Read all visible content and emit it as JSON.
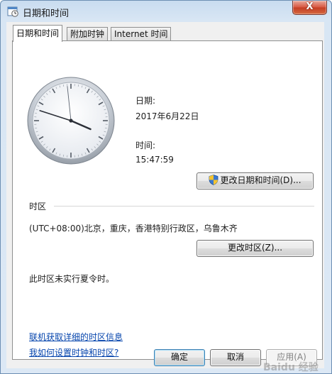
{
  "window": {
    "title": "日期和时间",
    "close_symbol": "X"
  },
  "tabs": [
    {
      "label": "日期和时间",
      "active": true
    },
    {
      "label": "附加时钟",
      "active": false
    },
    {
      "label": "Internet 时间",
      "active": false
    }
  ],
  "clock": {
    "time": "15:47:59"
  },
  "datetime": {
    "date_label": "日期:",
    "date_value": "2017年6月22日",
    "time_label": "时间:",
    "time_value": "15:47:59",
    "change_button": "更改日期和时间(D)..."
  },
  "timezone": {
    "section_title": "时区",
    "value": "(UTC+08:00)北京，重庆，香港特别行政区，乌鲁木齐",
    "change_button": "更改时区(Z)...",
    "dst_note": "此时区未实行夏令时。"
  },
  "links": {
    "online_info": "联机获取详细的时区信息",
    "how_to": "我如何设置时钟和时区?"
  },
  "footer": {
    "ok": "确定",
    "cancel": "取消",
    "apply": "应用(A)"
  },
  "watermark": "Baidu 经验",
  "colors": {
    "link": "#0645ad",
    "close_button": "#c43c24"
  },
  "icons": {
    "title": "clock-calendar-icon",
    "uac": "uac-shield-icon"
  }
}
